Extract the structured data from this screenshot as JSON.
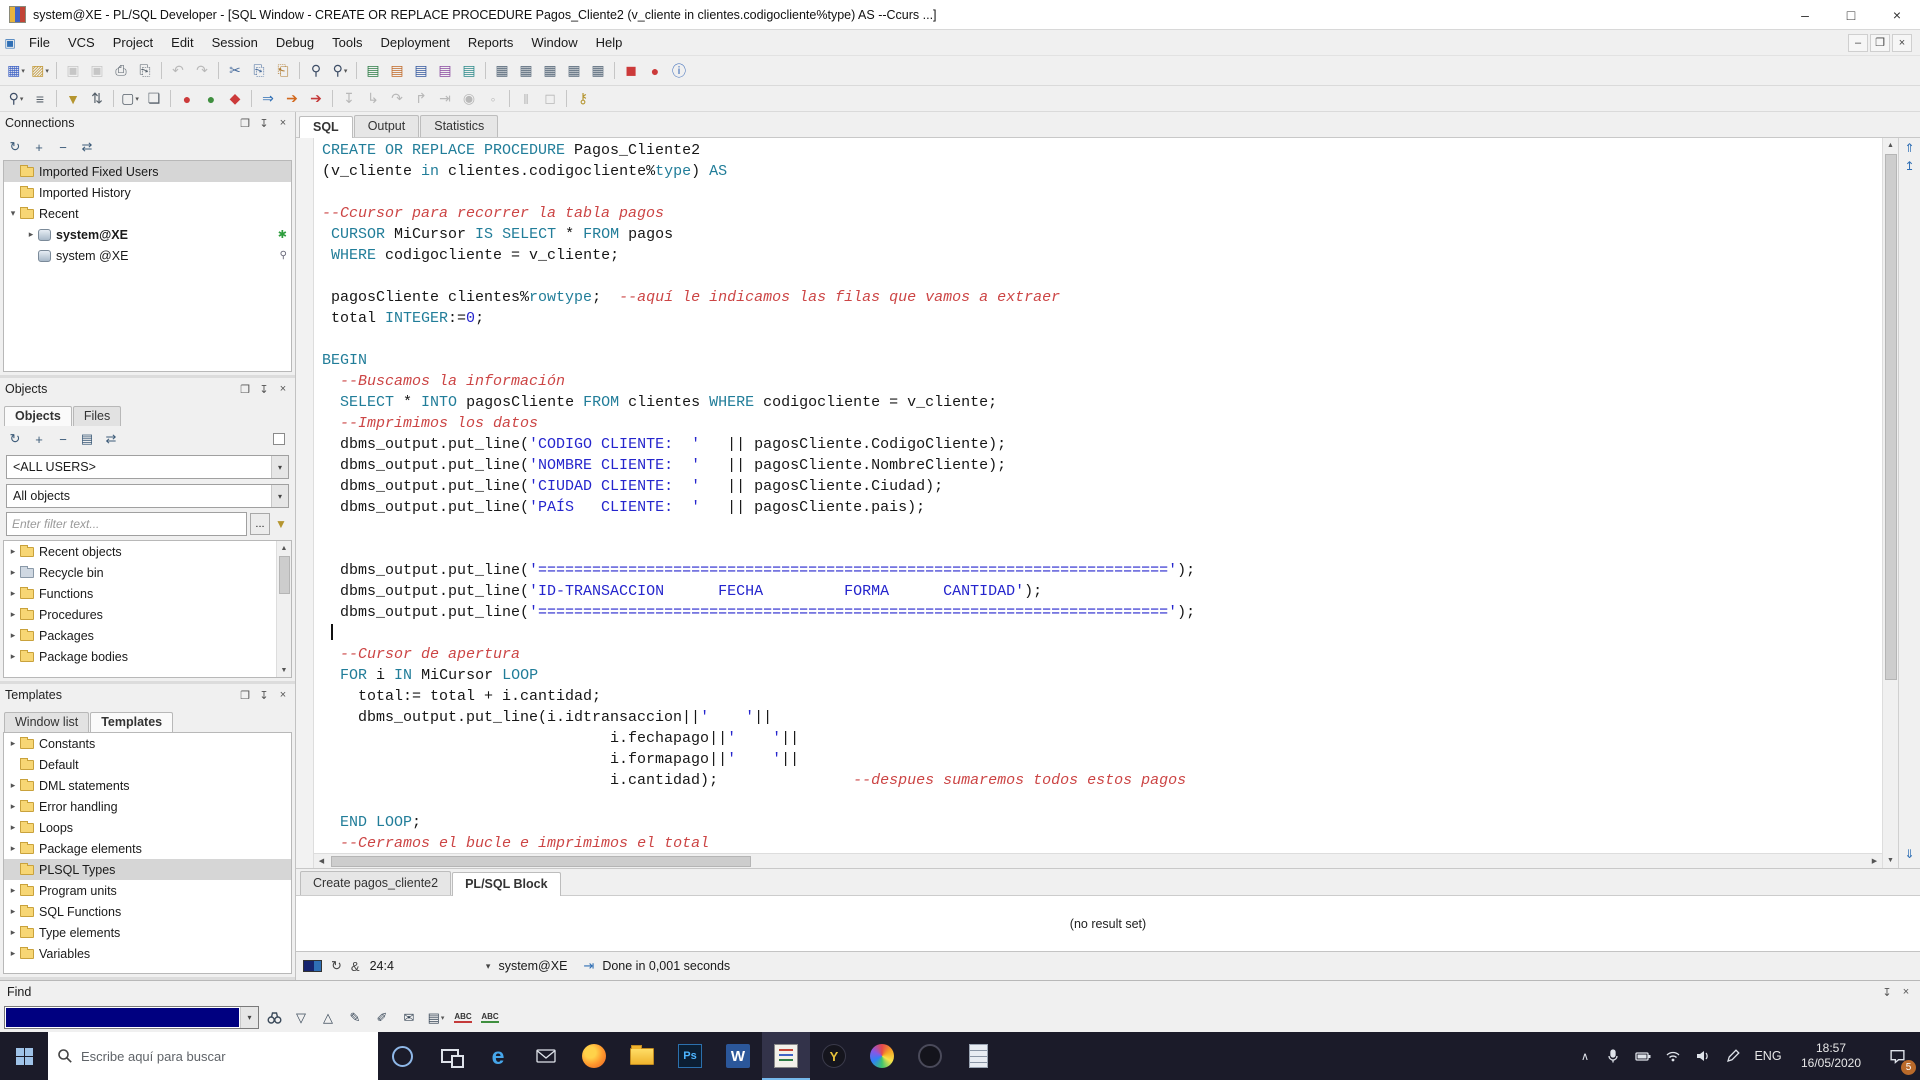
{
  "titlebar": {
    "title": "system@XE - PL/SQL Developer - [SQL Window - CREATE OR REPLACE PROCEDURE Pagos_Cliente2 (v_cliente in clientes.codigocliente%type) AS --Ccurs ...]"
  },
  "menubar": {
    "items": [
      "File",
      "VCS",
      "Project",
      "Edit",
      "Session",
      "Debug",
      "Tools",
      "Deployment",
      "Reports",
      "Window",
      "Help"
    ]
  },
  "icons": {
    "minimize": "–",
    "maximize": "□",
    "close": "×",
    "mdi_child": "▣",
    "mdi_minimize": "–",
    "mdi_restore": "❐",
    "mdi_close": "×",
    "dock": "❐",
    "pin": "↧",
    "panel_close": "×",
    "dropdown": "▾",
    "expand": "▸",
    "collapse": "▾",
    "refresh": "↻",
    "add": "+",
    "remove": "−",
    "swap": "⇄",
    "book": "▤",
    "gear": "⚙",
    "funnel": "▼",
    "more": "...",
    "scroll_up": "▲",
    "scroll_down": "▼",
    "scroll_left": "◀",
    "scroll_right": "▶",
    "nav_top": "⇑",
    "nav_prev": "↥",
    "nav_bottom": "⇓",
    "find_prev": "△",
    "find_next": "▽",
    "marker": "✎",
    "eraser": "✐",
    "mail": "✉",
    "doc": "▤",
    "amp": "&",
    "jump": "⇥",
    "chevron_up": "∧",
    "connected": "✱",
    "inspect": "⚲",
    "abc": "ABC"
  },
  "toolbar1": [
    {
      "n": "new-window",
      "g": "▦",
      "c": "#3f63c5",
      "drop": true
    },
    {
      "n": "open-file",
      "g": "▨",
      "c": "#c39a3a",
      "drop": true
    },
    {
      "sep": true
    },
    {
      "n": "save",
      "g": "▣",
      "c": "#7d858f",
      "d": true
    },
    {
      "n": "save-all",
      "g": "▣",
      "c": "#7d858f",
      "d": true
    },
    {
      "n": "print",
      "g": "⎙",
      "c": "#56606a"
    },
    {
      "n": "page-setup",
      "g": "⎘",
      "c": "#56606a"
    },
    {
      "sep": true
    },
    {
      "n": "undo",
      "g": "↶",
      "c": "#3f63c5",
      "d": true
    },
    {
      "n": "redo",
      "g": "↷",
      "c": "#3f63c5",
      "d": true
    },
    {
      "sep": true
    },
    {
      "n": "cut",
      "g": "✂",
      "c": "#4a6e9e"
    },
    {
      "n": "copy",
      "g": "⎘",
      "c": "#4a6e9e"
    },
    {
      "n": "paste",
      "g": "⎗",
      "c": "#b07a2e"
    },
    {
      "sep": true
    },
    {
      "n": "find",
      "g": "⚲",
      "c": "#3d4d66"
    },
    {
      "n": "find-next",
      "g": "⚲",
      "c": "#3d4d66",
      "drop": true
    },
    {
      "sep": true
    },
    {
      "n": "sql-window",
      "g": "▤",
      "c": "#2e7d46"
    },
    {
      "n": "test-window",
      "g": "▤",
      "c": "#c06a2a"
    },
    {
      "n": "command-window",
      "g": "▤",
      "c": "#35589e"
    },
    {
      "n": "report-window",
      "g": "▤",
      "c": "#8a4ba0"
    },
    {
      "n": "diagram-window",
      "g": "▤",
      "c": "#2c8a8a"
    },
    {
      "sep": true
    },
    {
      "n": "table-list",
      "g": "▦",
      "c": "#5a6b7c"
    },
    {
      "n": "code-assistant",
      "g": "▦",
      "c": "#5a6b7c"
    },
    {
      "n": "object-browser",
      "g": "▦",
      "c": "#5a6b7c"
    },
    {
      "n": "to-do-list",
      "g": "▦",
      "c": "#5a6b7c"
    },
    {
      "n": "window-list",
      "g": "▦",
      "c": "#5a6b7c"
    },
    {
      "sep": true
    },
    {
      "n": "stop-execution",
      "g": "◼",
      "c": "#cc3a3a"
    },
    {
      "n": "break-execution",
      "g": "●",
      "c": "#cc3a3a"
    },
    {
      "n": "help",
      "g": "ⓘ",
      "c": "#2b5fb4"
    }
  ],
  "toolbar2": [
    {
      "n": "browser-search",
      "g": "⚲",
      "c": "#3d4d66",
      "drop": true
    },
    {
      "n": "browser-list",
      "g": "≡",
      "c": "#56606a"
    },
    {
      "sep": true
    },
    {
      "n": "filter-results",
      "g": "▼",
      "c": "#b5952f"
    },
    {
      "n": "sort-results",
      "g": "⇅",
      "c": "#56606a"
    },
    {
      "sep": true
    },
    {
      "n": "new-item",
      "g": "▢",
      "c": "#56606a",
      "drop": true
    },
    {
      "n": "duplicate-item",
      "g": "❏",
      "c": "#56606a"
    },
    {
      "sep": true
    },
    {
      "n": "execute",
      "g": "●",
      "c": "#cc3a3a"
    },
    {
      "n": "execute-commit",
      "g": "●",
      "c": "#3f8f3f"
    },
    {
      "n": "break",
      "g": "◆",
      "c": "#cc3a3a"
    },
    {
      "sep": true
    },
    {
      "n": "run-script",
      "g": "⇒",
      "c": "#2f6fb5"
    },
    {
      "n": "run-current",
      "g": "➔",
      "c": "#d2691e"
    },
    {
      "n": "cancel-run",
      "g": "➔",
      "c": "#c43a3a"
    },
    {
      "sep": true
    },
    {
      "n": "debug-start",
      "g": "↧",
      "c": "#56606a",
      "d": true
    },
    {
      "n": "step-into",
      "g": "↳",
      "c": "#56606a",
      "d": true
    },
    {
      "n": "step-over",
      "g": "↷",
      "c": "#56606a",
      "d": true
    },
    {
      "n": "step-out",
      "g": "↱",
      "c": "#56606a",
      "d": true
    },
    {
      "n": "run-to-cursor",
      "g": "⇥",
      "c": "#56606a",
      "d": true
    },
    {
      "n": "add-watch",
      "g": "◉",
      "c": "#56606a",
      "d": true
    },
    {
      "n": "toggle-breakpoint",
      "g": "◦",
      "c": "#56606a",
      "d": true
    },
    {
      "sep": true
    },
    {
      "n": "pause",
      "g": "‖",
      "c": "#56606a",
      "d": true
    },
    {
      "n": "stop-debug",
      "g": "◻",
      "c": "#56606a",
      "d": true
    },
    {
      "sep": true
    },
    {
      "n": "unlock-session",
      "g": "⚷",
      "c": "#b5952f"
    }
  ],
  "connections_panel": {
    "title": "Connections",
    "items": [
      {
        "label": "Imported Fixed Users",
        "icon": "folder",
        "selected": true
      },
      {
        "label": "Imported History",
        "icon": "folder"
      },
      {
        "label": "Recent",
        "icon": "folder",
        "expanded": true
      },
      {
        "label": "system@XE",
        "icon": "db",
        "indent": 1,
        "bold": true,
        "badge": "connected",
        "children": true
      },
      {
        "label": "system @XE",
        "icon": "db",
        "indent": 1,
        "badge": "inspect"
      }
    ]
  },
  "objects_panel": {
    "title": "Objects",
    "tabs": [
      "Objects",
      "Files"
    ],
    "user_filter": "<ALL USERS>",
    "object_filter": "All objects",
    "filter_placeholder": "Enter filter text...",
    "items": [
      {
        "label": "Recent objects",
        "icon": "folder"
      },
      {
        "label": "Recycle bin",
        "icon": "bin"
      },
      {
        "label": "Functions",
        "icon": "folder"
      },
      {
        "label": "Procedures",
        "icon": "folder"
      },
      {
        "label": "Packages",
        "icon": "folder"
      },
      {
        "label": "Package bodies",
        "icon": "folder"
      }
    ]
  },
  "templates_panel": {
    "title": "Templates",
    "tabs": [
      "Window list",
      "Templates"
    ],
    "items": [
      {
        "label": "Constants",
        "arrow": true
      },
      {
        "label": "Default",
        "arrow": false
      },
      {
        "label": "DML statements",
        "arrow": true
      },
      {
        "label": "Error handling",
        "arrow": true
      },
      {
        "label": "Loops",
        "arrow": true
      },
      {
        "label": "Package elements",
        "arrow": true
      },
      {
        "label": "PLSQL Types",
        "arrow": false,
        "selected": true
      },
      {
        "label": "Program units",
        "arrow": true
      },
      {
        "label": "SQL Functions",
        "arrow": true
      },
      {
        "label": "Type elements",
        "arrow": true
      },
      {
        "label": "Variables",
        "arrow": true
      }
    ]
  },
  "editor": {
    "tabs": [
      "SQL",
      "Output",
      "Statistics"
    ],
    "caret_line": 24,
    "caret_col": 1,
    "code": [
      [
        [
          "k",
          "CREATE OR REPLACE PROCEDURE"
        ],
        [
          "p",
          " Pagos_Cliente2"
        ]
      ],
      [
        [
          "p",
          "(v_cliente "
        ],
        [
          "k",
          "in"
        ],
        [
          "p",
          " clientes.codigocliente%"
        ],
        [
          "k",
          "type"
        ],
        [
          "p",
          ") "
        ],
        [
          "k",
          "AS"
        ]
      ],
      [],
      [
        [
          "c",
          "--Ccursor para recorrer la tabla pagos"
        ]
      ],
      [
        [
          "p",
          " "
        ],
        [
          "k",
          "CURSOR"
        ],
        [
          "p",
          " MiCursor "
        ],
        [
          "k",
          "IS"
        ],
        [
          "p",
          " "
        ],
        [
          "k",
          "SELECT"
        ],
        [
          "p",
          " * "
        ],
        [
          "k",
          "FROM"
        ],
        [
          "p",
          " pagos"
        ]
      ],
      [
        [
          "p",
          " "
        ],
        [
          "k",
          "WHERE"
        ],
        [
          "p",
          " codigocliente = v_cliente;"
        ]
      ],
      [],
      [
        [
          "p",
          " pagosCliente clientes%"
        ],
        [
          "k",
          "rowtype"
        ],
        [
          "p",
          ";  "
        ],
        [
          "c",
          "--aquí le indicamos las filas que vamos a extraer"
        ]
      ],
      [
        [
          "p",
          " total "
        ],
        [
          "k",
          "INTEGER"
        ],
        [
          "p",
          ":="
        ],
        [
          "n",
          "0"
        ],
        [
          "p",
          ";"
        ]
      ],
      [],
      [
        [
          "k",
          "BEGIN"
        ]
      ],
      [
        [
          "p",
          "  "
        ],
        [
          "c",
          "--Buscamos la información"
        ]
      ],
      [
        [
          "p",
          "  "
        ],
        [
          "k",
          "SELECT"
        ],
        [
          "p",
          " * "
        ],
        [
          "k",
          "INTO"
        ],
        [
          "p",
          " pagosCliente "
        ],
        [
          "k",
          "FROM"
        ],
        [
          "p",
          " clientes "
        ],
        [
          "k",
          "WHERE"
        ],
        [
          "p",
          " codigocliente = v_cliente;"
        ]
      ],
      [
        [
          "p",
          "  "
        ],
        [
          "c",
          "--Imprimimos los datos"
        ]
      ],
      [
        [
          "p",
          "  dbms_output.put_line("
        ],
        [
          "s",
          "'CODIGO CLIENTE:  '"
        ],
        [
          "p",
          "   || pagosCliente.CodigoCliente);"
        ]
      ],
      [
        [
          "p",
          "  dbms_output.put_line("
        ],
        [
          "s",
          "'NOMBRE CLIENTE:  '"
        ],
        [
          "p",
          "   || pagosCliente.NombreCliente);"
        ]
      ],
      [
        [
          "p",
          "  dbms_output.put_line("
        ],
        [
          "s",
          "'CIUDAD CLIENTE:  '"
        ],
        [
          "p",
          "   || pagosCliente.Ciudad);"
        ]
      ],
      [
        [
          "p",
          "  dbms_output.put_line("
        ],
        [
          "s",
          "'PAÍS   CLIENTE:  '"
        ],
        [
          "p",
          "   || pagosCliente.pais);"
        ]
      ],
      [],
      [],
      [
        [
          "p",
          "  dbms_output.put_line("
        ],
        [
          "s",
          "'======================================================================'"
        ],
        [
          "p",
          ");"
        ]
      ],
      [
        [
          "p",
          "  dbms_output.put_line("
        ],
        [
          "s",
          "'ID-TRANSACCION      FECHA         FORMA      CANTIDAD'"
        ],
        [
          "p",
          ");"
        ]
      ],
      [
        [
          "p",
          "  dbms_output.put_line("
        ],
        [
          "s",
          "'======================================================================'"
        ],
        [
          "p",
          ");"
        ]
      ],
      [],
      [
        [
          "p",
          "  "
        ],
        [
          "c",
          "--Cursor de apertura"
        ]
      ],
      [
        [
          "p",
          "  "
        ],
        [
          "k",
          "FOR"
        ],
        [
          "p",
          " i "
        ],
        [
          "k",
          "IN"
        ],
        [
          "p",
          " MiCursor "
        ],
        [
          "k",
          "LOOP"
        ]
      ],
      [
        [
          "p",
          "    total:= total + i.cantidad;"
        ]
      ],
      [
        [
          "p",
          "    dbms_output.put_line(i.idtransaccion||"
        ],
        [
          "s",
          "'    '"
        ],
        [
          "p",
          "||"
        ]
      ],
      [
        [
          "p",
          "                                i.fechapago||"
        ],
        [
          "s",
          "'    '"
        ],
        [
          "p",
          "||"
        ]
      ],
      [
        [
          "p",
          "                                i.formapago||"
        ],
        [
          "s",
          "'    '"
        ],
        [
          "p",
          "||"
        ]
      ],
      [
        [
          "p",
          "                                i.cantidad);               "
        ],
        [
          "c",
          "--despues sumaremos todos estos pagos"
        ]
      ],
      [],
      [
        [
          "p",
          "  "
        ],
        [
          "k",
          "END LOOP"
        ],
        [
          "p",
          ";"
        ]
      ],
      [
        [
          "p",
          "  "
        ],
        [
          "c",
          "--Cerramos el bucle e imprimimos el total"
        ]
      ]
    ]
  },
  "result": {
    "tabs": [
      "Create pagos_cliente2",
      "PL/SQL Block"
    ],
    "text": "(no result set)"
  },
  "statusbar": {
    "position": "24:4",
    "connection": "system@XE",
    "message": "Done in 0,001 seconds"
  },
  "find_panel": {
    "title": "Find"
  },
  "taskbar": {
    "search_placeholder": "Escribe aquí para buscar",
    "language": "ENG",
    "time": "18:57",
    "date": "16/05/2020",
    "badge": "5",
    "apps": [
      {
        "n": "cortana",
        "kind": "cortana"
      },
      {
        "n": "task-view",
        "kind": "taskview"
      },
      {
        "n": "edge",
        "kind": "edge",
        "letter": "e"
      },
      {
        "n": "mail",
        "kind": "mail"
      },
      {
        "n": "firefox",
        "kind": "firefox"
      },
      {
        "n": "file-explorer",
        "kind": "explorer"
      },
      {
        "n": "photoshop",
        "kind": "ps",
        "letter": "Ps"
      },
      {
        "n": "word",
        "kind": "word",
        "letter": "W"
      },
      {
        "n": "plsql-developer",
        "kind": "plsql",
        "active": true
      },
      {
        "n": "y-app",
        "kind": "ycircle",
        "letter": "Y"
      },
      {
        "n": "media-app",
        "kind": "pinwheel"
      },
      {
        "n": "dark-app",
        "kind": "darkcircle"
      },
      {
        "n": "notepad",
        "kind": "notepad"
      }
    ]
  },
  "colors": {
    "keyword": "#217d99",
    "string": "#2525cd",
    "number": "#2525cd",
    "comment": "#cc4545",
    "selection": "#d6d6d6",
    "taskbar": "#1b1b29",
    "find_selection": "#000080"
  }
}
